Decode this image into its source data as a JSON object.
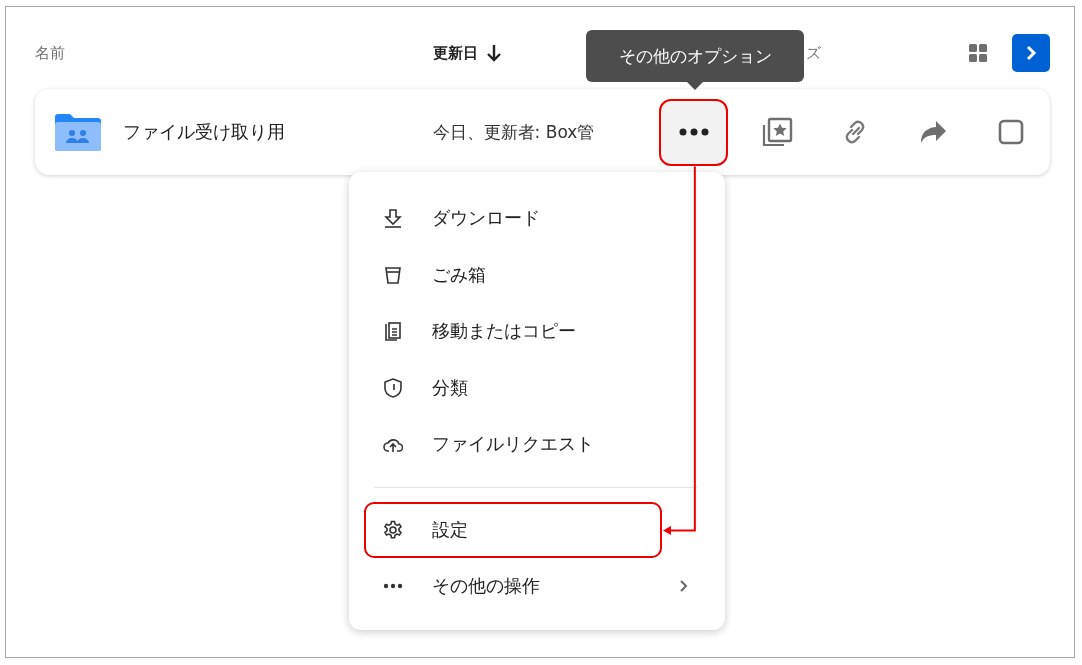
{
  "header": {
    "columns": [
      {
        "label": "名前",
        "sorted": false
      },
      {
        "label": "更新日",
        "sorted": true
      },
      {
        "label": "ズ",
        "sorted": false
      }
    ],
    "view_toggle": {
      "selected": true
    }
  },
  "row": {
    "name": "ファイル受け取り用",
    "modified": "今日、更新者: Box管",
    "more_button": {
      "annotated": true
    }
  },
  "tooltip": {
    "text": "その他のオプション"
  },
  "menu": {
    "items": [
      {
        "kind": "download",
        "label": "ダウンロード",
        "annotated": false
      },
      {
        "kind": "trash",
        "label": "ごみ箱",
        "annotated": false
      },
      {
        "kind": "copy",
        "label": "移動またはコピー",
        "annotated": false
      },
      {
        "kind": "classify",
        "label": "分類",
        "annotated": false
      },
      {
        "kind": "request",
        "label": "ファイルリクエスト",
        "annotated": false
      },
      {
        "kind": "divider"
      },
      {
        "kind": "settings",
        "label": "設定",
        "annotated": true
      },
      {
        "kind": "more",
        "label": "その他の操作",
        "annotated": false,
        "submenu": true
      }
    ]
  }
}
